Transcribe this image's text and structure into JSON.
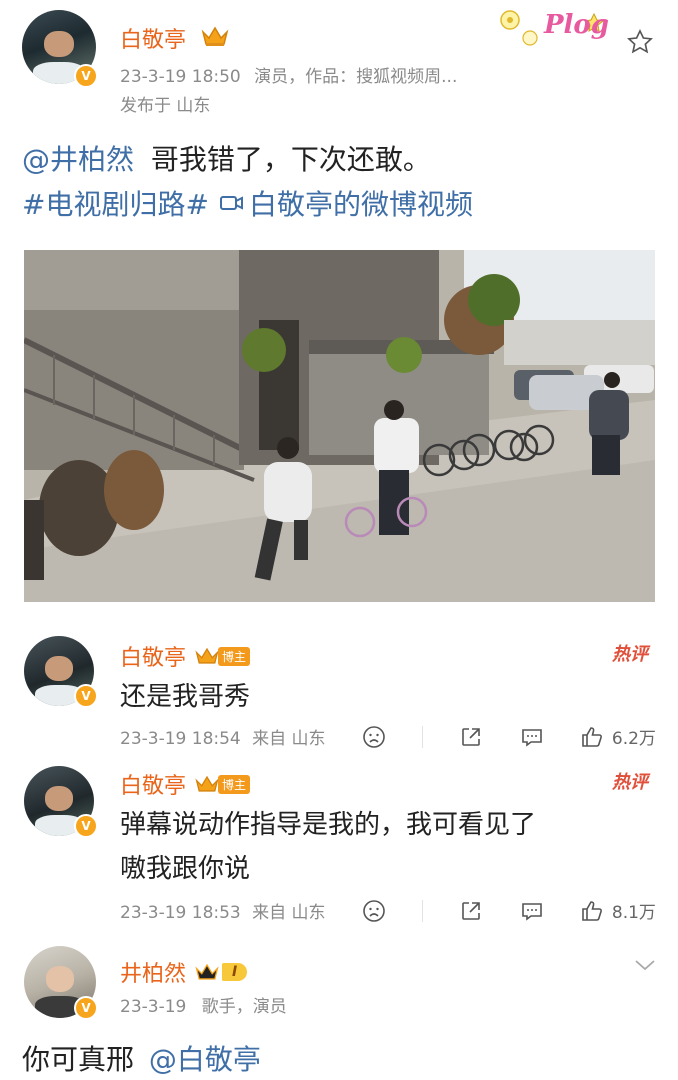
{
  "post": {
    "author": "白敬亭",
    "time": "23-3-19 18:50",
    "meta": "演员，作品：搜狐视频周...",
    "location": "发布于 山东",
    "mention": "@井柏然",
    "text": "哥我错了，下次还敢。",
    "hashtag": "#电视剧归路#",
    "video_link": "白敬亭的微博视频",
    "badge_text": "Plog"
  },
  "comments": [
    {
      "author": "白敬亭",
      "badge": "博主",
      "hot_label": "热评",
      "text": "还是我哥秀",
      "time": "23-3-19 18:54",
      "location": "来自 山东",
      "likes": "6.2万"
    },
    {
      "author": "白敬亭",
      "badge": "博主",
      "hot_label": "热评",
      "text_line1": "弹幕说动作指导是我的，我可看见了",
      "text_line2": "嗷我跟你说",
      "time": "23-3-19 18:53",
      "location": "来自 山东",
      "likes": "8.1万"
    }
  ],
  "reply": {
    "author": "井柏然",
    "level_badge": "I",
    "time": "23-3-19",
    "meta": "歌手，演员",
    "text": "你可真邢",
    "mention": "@白敬亭"
  },
  "colors": {
    "name": "#e8651b",
    "link": "#3f6fa6",
    "hot": "#e0503a",
    "gray": "#8a8a8a"
  }
}
